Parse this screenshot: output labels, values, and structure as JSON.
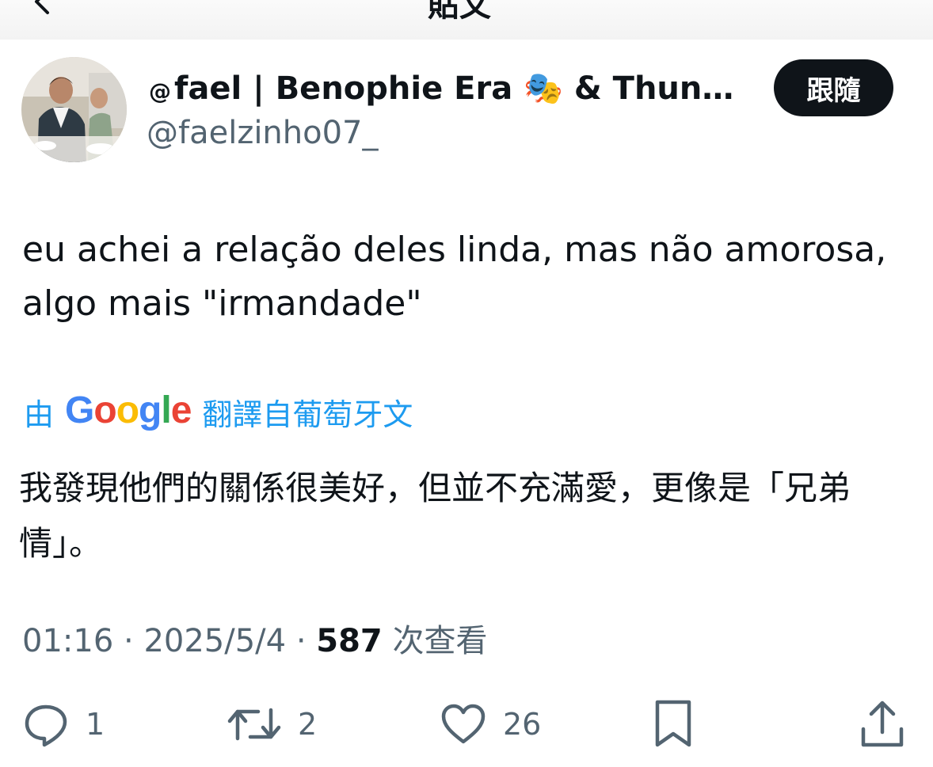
{
  "header": {
    "title": "貼文"
  },
  "author": {
    "display_name_prefix": "@",
    "display_name": "fael | Benophie Era 🎭 & Thunde...",
    "handle": "@faelzinho07_",
    "avatar_icon": "avatar-photo"
  },
  "follow_button": {
    "label": "跟隨"
  },
  "tweet": {
    "text": "eu achei a relação deles linda, mas não amorosa, algo mais \"irmandade\""
  },
  "translation": {
    "prefix": "由",
    "provider": "Google",
    "suffix": "翻譯自葡萄牙文",
    "text": "我發現他們的關係很美好，但並不充滿愛，更像是「兄弟情」。"
  },
  "meta": {
    "time": "01:16",
    "separator": "·",
    "date": "2025/5/4",
    "views": "587",
    "views_label": "次查看"
  },
  "actions": {
    "reply_count": "1",
    "retweet_count": "2",
    "like_count": "26"
  },
  "colors": {
    "text": "#0f1419",
    "secondary": "#536471",
    "link": "#1d9bf0",
    "button_bg": "#0f1419"
  }
}
